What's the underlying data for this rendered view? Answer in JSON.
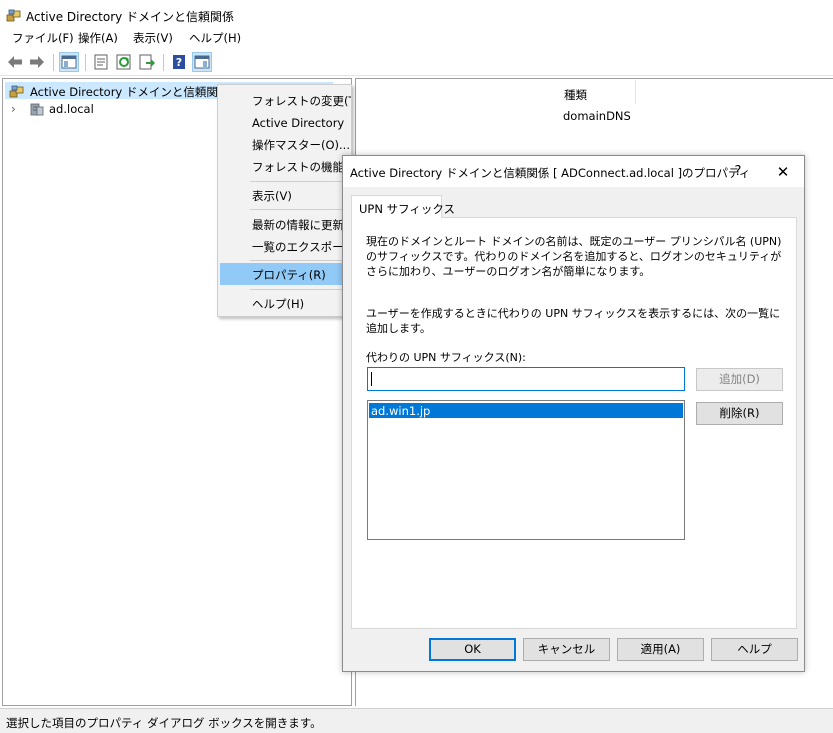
{
  "window": {
    "title": "Active Directory ドメインと信頼関係",
    "icon": "ad-domains-trusts-icon"
  },
  "menubar": {
    "items": [
      "ファイル(F)",
      "操作(A)",
      "表示(V)",
      "ヘルプ(H)"
    ]
  },
  "toolbar": {
    "icons": [
      "back-arrow-icon",
      "forward-arrow-icon",
      "show-console-tree-icon",
      "properties-icon",
      "refresh-icon",
      "export-list-icon",
      "help-icon",
      "show-action-pane-icon"
    ]
  },
  "tree": {
    "root_label": "Active Directory ドメインと信頼関係 [",
    "child_label": "ad.local",
    "chevron": "›"
  },
  "list": {
    "column_header": "種類",
    "cell_value": "domainDNS"
  },
  "context_menu": {
    "items": [
      "フォレストの変更(T)...",
      "Active Directory ドメイン コントローラーの変更(C)...",
      "操作マスター(O)...",
      "フォレストの機能レベル",
      "表示(V)",
      "最新の情報に更新",
      "一覧のエクスポート(",
      "プロパティ(R)",
      "ヘルプ(H)"
    ],
    "highlighted": "プロパティ(R)"
  },
  "dialog": {
    "title": "Active Directory ドメインと信頼関係 [ ADConnect.ad.local ]のプロパティ",
    "help_glyph": "?",
    "close_glyph": "✕",
    "tab_label": "UPN サフィックス",
    "description1": "現在のドメインとルート ドメインの名前は、既定のユーザー プリンシパル名 (UPN) のサフィックスです。代わりのドメイン名を追加すると、ログオンのセキュリティがさらに加わり、ユーザーのログオン名が簡単になります。",
    "description2": "ユーザーを作成するときに代わりの UPN サフィックスを表示するには、次の一覧に追加します。",
    "alt_upn_label": "代わりの UPN サフィックス(N):",
    "input_value": "",
    "upn_suffixes": [
      "ad.win1.jp"
    ],
    "add_button": "追加(D)",
    "remove_button": "削除(R)",
    "ok_button": "OK",
    "cancel_button": "キャンセル",
    "apply_button": "適用(A)",
    "help_button": "ヘルプ"
  },
  "status_bar": {
    "text": "選択した項目のプロパティ ダイアログ ボックスを開きます。"
  },
  "colors": {
    "selection_blue": "#0078d7",
    "tree_selection": "#cce8ff",
    "menu_highlight": "#91c9f7",
    "dialog_bg": "#f0f0f0"
  }
}
